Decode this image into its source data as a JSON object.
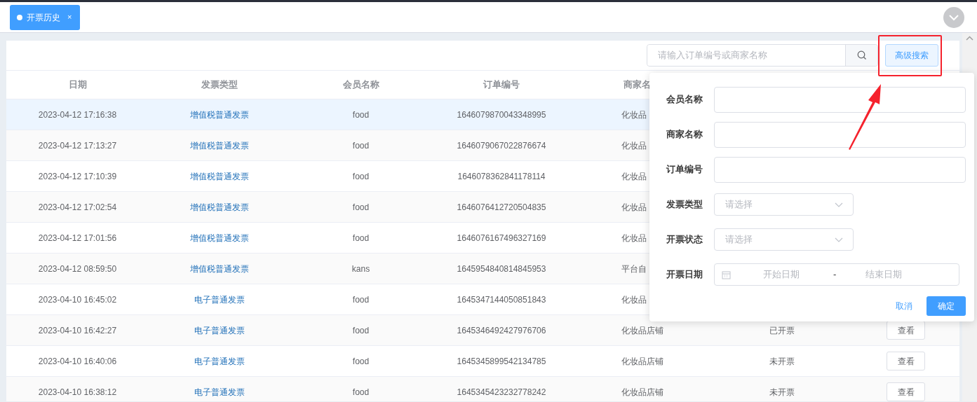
{
  "tabs": [
    {
      "label": "开票历史",
      "close": "×",
      "selected": true
    }
  ],
  "search": {
    "placeholder": "请输入订单编号或商家名称"
  },
  "advanced_button": "高级搜索",
  "table": {
    "columns": [
      "日期",
      "发票类型",
      "会员名称",
      "订单编号",
      "商家名"
    ],
    "rows": [
      {
        "date": "2023-04-12 17:16:38",
        "invoice_type": "增值税普通发票",
        "member": "food",
        "order_no": "1646079870043348995",
        "merchant": "化妆品",
        "highlighted": true
      },
      {
        "date": "2023-04-12 17:13:27",
        "invoice_type": "增值税普通发票",
        "member": "food",
        "order_no": "1646079067022876674",
        "merchant": "化妆品",
        "highlighted": false
      },
      {
        "date": "2023-04-12 17:10:39",
        "invoice_type": "增值税普通发票",
        "member": "food",
        "order_no": "1646078362841178114",
        "merchant": "化妆品",
        "highlighted": false
      },
      {
        "date": "2023-04-12 17:02:54",
        "invoice_type": "增值税普通发票",
        "member": "food",
        "order_no": "1646076412720504835",
        "merchant": "化妆品",
        "highlighted": false
      },
      {
        "date": "2023-04-12 17:01:56",
        "invoice_type": "增值税普通发票",
        "member": "food",
        "order_no": "1646076167496327169",
        "merchant": "化妆品",
        "highlighted": false
      },
      {
        "date": "2023-04-12 08:59:50",
        "invoice_type": "增值税普通发票",
        "member": "kans",
        "order_no": "1645954840814845953",
        "merchant": "平台自",
        "highlighted": false
      },
      {
        "date": "2023-04-10 16:45:02",
        "invoice_type": "电子普通发票",
        "member": "food",
        "order_no": "1645347144050851843",
        "merchant": "化妆品",
        "highlighted": false
      },
      {
        "date": "2023-04-10 16:42:27",
        "invoice_type": "电子普通发票",
        "member": "food",
        "order_no": "1645346492427976706",
        "merchant": "化妆品店铺",
        "status": "已开票",
        "action": "查看",
        "highlighted": false
      },
      {
        "date": "2023-04-10 16:40:06",
        "invoice_type": "电子普通发票",
        "member": "food",
        "order_no": "1645345899542134785",
        "merchant": "化妆品店铺",
        "status": "未开票",
        "action": "查看",
        "highlighted": false
      },
      {
        "date": "2023-04-10 16:38:12",
        "invoice_type": "电子普通发票",
        "member": "food",
        "order_no": "1645345423232778242",
        "merchant": "化妆品店铺",
        "status": "未开票",
        "action": "查看",
        "highlighted": false
      }
    ]
  },
  "advanced_search": {
    "fields": [
      {
        "kind": "text",
        "label": "会员名称"
      },
      {
        "kind": "text",
        "label": "商家名称"
      },
      {
        "kind": "text",
        "label": "订单编号"
      },
      {
        "kind": "select",
        "label": "发票类型",
        "placeholder": "请选择"
      },
      {
        "kind": "select",
        "label": "开票状态",
        "placeholder": "请选择"
      },
      {
        "kind": "daterange",
        "label": "开票日期",
        "start_placeholder": "开始日期",
        "separator": "-",
        "end_placeholder": "结束日期"
      }
    ],
    "cancel": "取消",
    "confirm": "确定"
  }
}
